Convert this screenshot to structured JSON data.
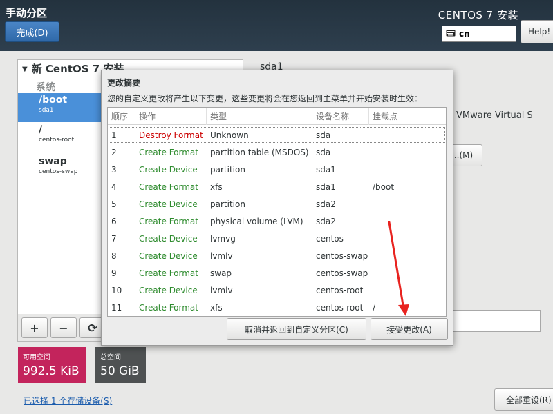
{
  "header": {
    "title": "手动分区",
    "done_button": "完成(D)",
    "product_title": "CENTOS 7 安装",
    "keyboard_layout": "cn",
    "help_button": "Help!"
  },
  "left_panel": {
    "install_header": "新 CentOS 7 安装",
    "system_label": "系统",
    "mountpoints": [
      {
        "name": "/boot",
        "device": "sda1",
        "selected": true
      },
      {
        "name": "/",
        "device": "centos-root",
        "selected": false
      },
      {
        "name": "swap",
        "device": "centos-swap",
        "selected": false
      }
    ],
    "toolbar": {
      "add": "+",
      "remove": "−",
      "refresh": "⟳"
    }
  },
  "space": {
    "available_label": "可用空间",
    "available_value": "992.5 KiB",
    "total_label": "总空间",
    "total_value": "50 GiB"
  },
  "storage_link": "已选择 1 个存储设备(S)",
  "reset_button": "全部重设(R)",
  "right_panel": {
    "title": "sda1",
    "disk_label": "VMware Virtual S",
    "modify_button": "...(M)"
  },
  "modal": {
    "title": "更改摘要",
    "description": "您的自定义更改将产生以下变更，这些变更将会在您返回到主菜单并开始安装时生效：",
    "columns": [
      "顺序",
      "操作",
      "类型",
      "设备名称",
      "挂载点"
    ],
    "rows": [
      {
        "order": "1",
        "action": "Destroy Format",
        "type": "Unknown",
        "device": "sda",
        "mount": "",
        "kind": "destroy"
      },
      {
        "order": "2",
        "action": "Create Format",
        "type": "partition table (MSDOS)",
        "device": "sda",
        "mount": "",
        "kind": "create"
      },
      {
        "order": "3",
        "action": "Create Device",
        "type": "partition",
        "device": "sda1",
        "mount": "",
        "kind": "create"
      },
      {
        "order": "4",
        "action": "Create Format",
        "type": "xfs",
        "device": "sda1",
        "mount": "/boot",
        "kind": "create"
      },
      {
        "order": "5",
        "action": "Create Device",
        "type": "partition",
        "device": "sda2",
        "mount": "",
        "kind": "create"
      },
      {
        "order": "6",
        "action": "Create Format",
        "type": "physical volume (LVM)",
        "device": "sda2",
        "mount": "",
        "kind": "create"
      },
      {
        "order": "7",
        "action": "Create Device",
        "type": "lvmvg",
        "device": "centos",
        "mount": "",
        "kind": "create"
      },
      {
        "order": "8",
        "action": "Create Device",
        "type": "lvmlv",
        "device": "centos-swap",
        "mount": "",
        "kind": "create"
      },
      {
        "order": "9",
        "action": "Create Format",
        "type": "swap",
        "device": "centos-swap",
        "mount": "",
        "kind": "create"
      },
      {
        "order": "10",
        "action": "Create Device",
        "type": "lvmlv",
        "device": "centos-root",
        "mount": "",
        "kind": "create"
      },
      {
        "order": "11",
        "action": "Create Format",
        "type": "xfs",
        "device": "centos-root",
        "mount": "/",
        "kind": "create"
      }
    ],
    "cancel_button": "取消并返回到自定义分区(C)",
    "accept_button": "接受更改(A)"
  },
  "colors": {
    "destroy_action": "#cc0000",
    "create_action": "#2e8b2e",
    "selection": "#4a90d9",
    "available_space": "#c3245c",
    "annotation_arrow": "#e8231f"
  }
}
